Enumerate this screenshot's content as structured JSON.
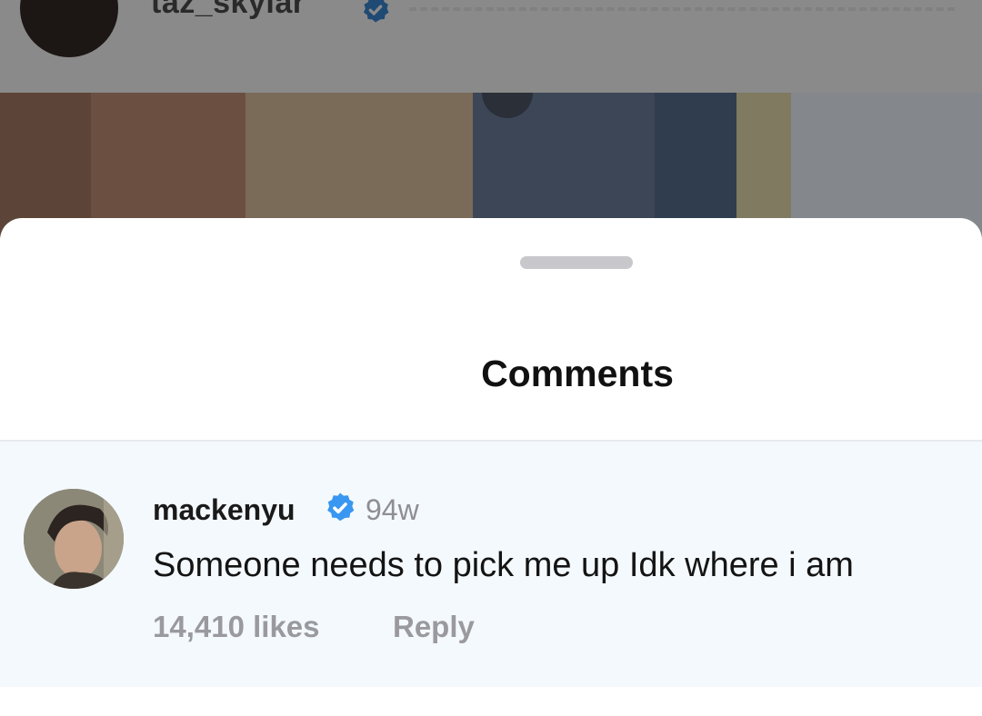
{
  "post": {
    "username": "taz_skylar"
  },
  "sheet": {
    "title": "Comments"
  },
  "comment": {
    "username": "mackenyu",
    "time": "94w",
    "text": "Someone needs to pick me up Idk where i am",
    "likes": "14,410 likes",
    "reply_label": "Reply"
  },
  "colors": {
    "verified_badge": "#3897f0",
    "comment_background": "#f4f9fd",
    "secondary_text": "#8e8e93"
  },
  "icons": {
    "verified": "verified-badge-icon"
  }
}
